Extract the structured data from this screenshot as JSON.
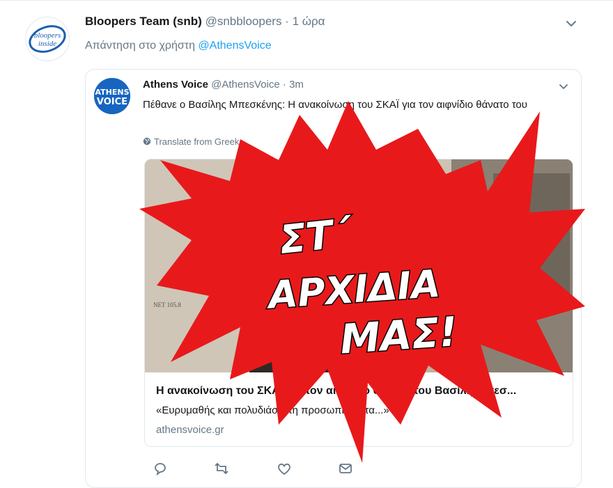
{
  "tweet": {
    "author_name": "Bloopers Team (snb)",
    "author_handle": "@snbbloopers",
    "separator": " · ",
    "time": "1 ώρα",
    "reply_prefix": "Απάντηση στο χρήστη ",
    "reply_to": "@AthensVoice",
    "avatar_text_1": "bloopers",
    "avatar_text_2": "inside"
  },
  "quote": {
    "author_name": "Athens Voice",
    "author_handle": "@AthensVoice",
    "separator": " · ",
    "time": "3m",
    "text": "Πέθανε ο Βασίλης Μπεσκένης: Η ανακοίνωση του ΣΚΑΪ για τον αιφνίδιο θάνατο του",
    "translate": "Translate from Greek",
    "avatar_line_1": "ATHENS",
    "avatar_line_2": "VOICE",
    "photo_caption": "NET 105.8"
  },
  "card": {
    "title": "Η ανακοίνωση του ΣΚΑΪ για τον αιφνίδιο θάνατο του Βασίλη Μπεσ...",
    "description": "«Ευρυμαθής και πολυδιάστατη προσωπικότητα...»",
    "domain": "athensvoice.gr"
  },
  "overlay": {
    "line_1": "ΣΤ΄",
    "line_2": "ΑΡΧΙΔΙΑ",
    "line_3": "ΜΑΣ!",
    "color": "#e8191b"
  },
  "colors": {
    "link": "#1da1f2",
    "muted": "#657786",
    "text": "#14171a",
    "border": "#e1e8ed"
  },
  "icons": [
    "chevron-down-icon",
    "globe-icon",
    "reply-icon",
    "retweet-icon",
    "like-icon",
    "message-icon"
  ]
}
